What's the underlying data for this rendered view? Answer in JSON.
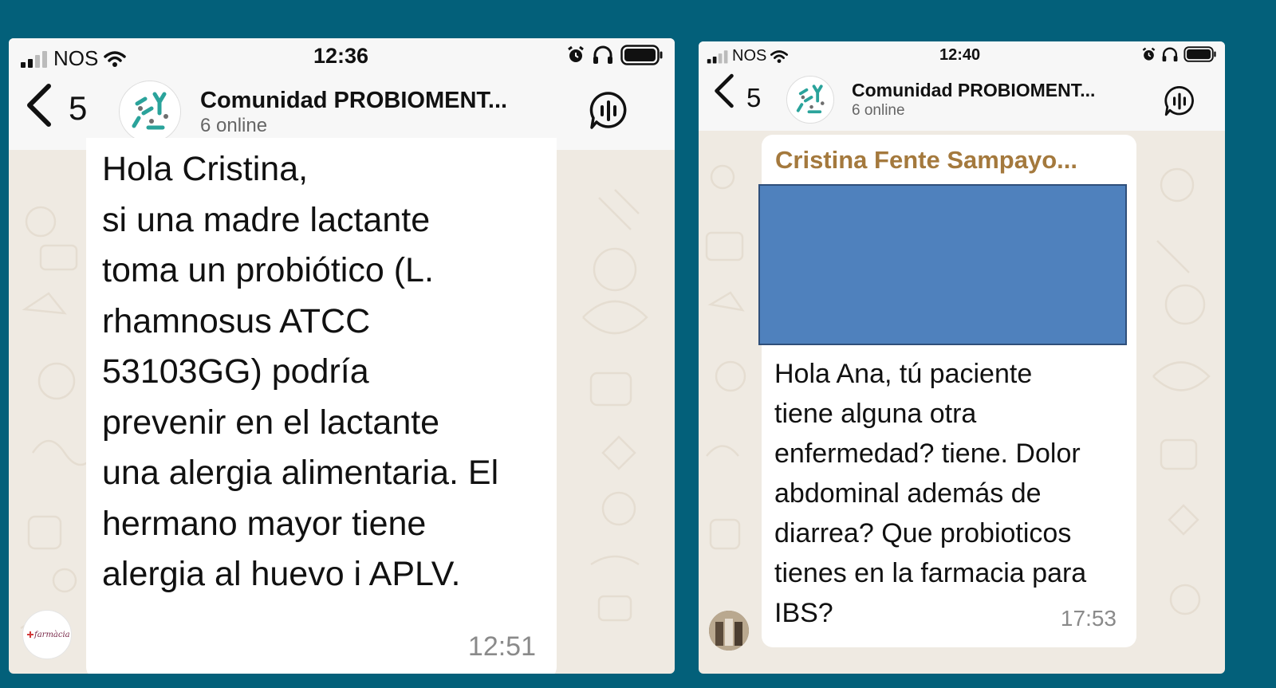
{
  "left_chat": {
    "status": {
      "carrier": "NOS",
      "time": "12:36"
    },
    "header": {
      "back_count": "5",
      "group_name": "Comunidad PROBIOMENT...",
      "members_online": "6 online"
    },
    "message": {
      "lines": [
        "Hola Cristina,",
        "si una madre lactante",
        "toma un probiótico (L.",
        "rhamnosus ATCC",
        "53103GG) podría",
        "prevenir en el lactante",
        "una alergia alimentaria. El",
        "hermano mayor tiene",
        "alergia al huevo i APLV."
      ],
      "time": "12:51"
    },
    "sender_avatar_text": "farmàcia"
  },
  "right_chat": {
    "status": {
      "carrier": "NOS",
      "time": "12:40"
    },
    "header": {
      "back_count": "5",
      "group_name": "Comunidad PROBIOMENT...",
      "members_online": "6 online"
    },
    "message": {
      "sender": "Cristina Fente Sampayo...",
      "lines": [
        "Hola Ana, tú paciente",
        "tiene alguna otra",
        "enfermedad? tiene. Dolor",
        "abdominal además de",
        "diarrea? Que probioticos",
        "tienes en la farmacia para",
        "IBS?"
      ],
      "time": "17:53"
    }
  },
  "colors": {
    "page_background": "#03607a",
    "chat_wallpaper": "#efeae2",
    "bubble": "#ffffff",
    "sender_name": "#a4793d",
    "redaction_box": "#4f81bd"
  },
  "icons": {
    "status_left": [
      "signal-bars-icon",
      "wifi-icon"
    ],
    "status_right": [
      "alarm-icon",
      "headphones-icon",
      "battery-icon"
    ],
    "header": [
      "back-chevron-icon",
      "group-avatar-icon",
      "voice-chat-icon"
    ]
  }
}
